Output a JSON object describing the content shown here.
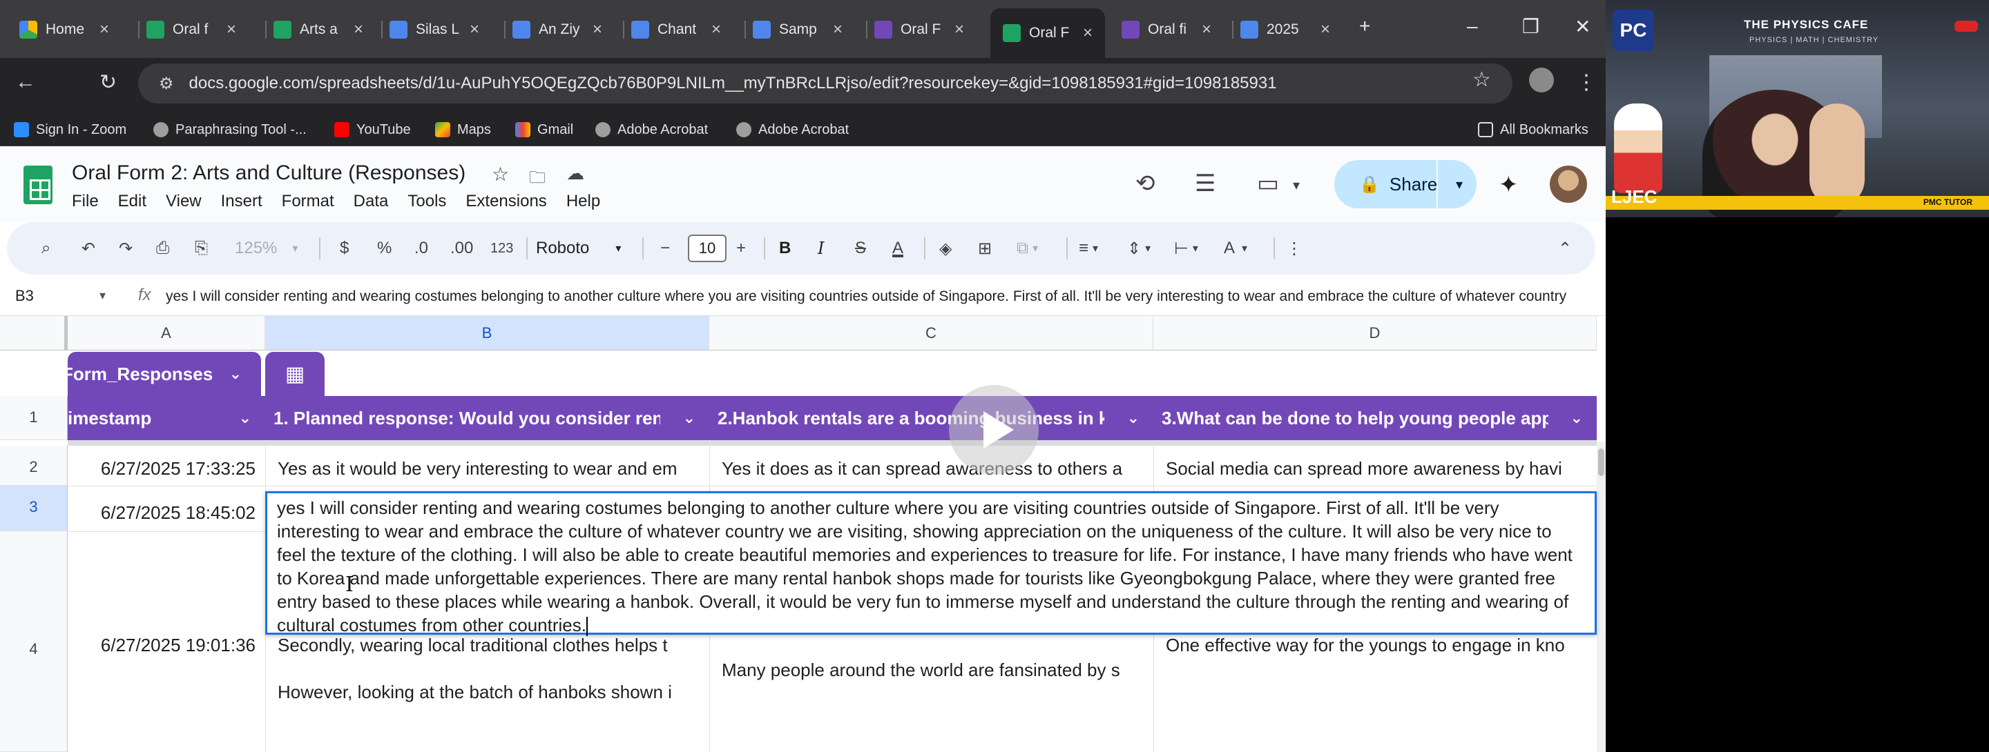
{
  "browser": {
    "tabs": [
      {
        "title": "Home",
        "icon": "drive-icon",
        "active": false
      },
      {
        "title": "Oral f",
        "icon": "sheets-icon",
        "active": false
      },
      {
        "title": "Arts a",
        "icon": "sheets-icon",
        "active": false
      },
      {
        "title": "Silas L",
        "icon": "docs-icon",
        "active": false
      },
      {
        "title": "An Ziy",
        "icon": "docs-icon",
        "active": false
      },
      {
        "title": "Chant",
        "icon": "docs-icon",
        "active": false
      },
      {
        "title": "Samp",
        "icon": "docs-icon",
        "active": false
      },
      {
        "title": "Oral F",
        "icon": "forms-icon",
        "active": false
      },
      {
        "title": "Oral F",
        "icon": "sheets-icon",
        "active": true
      },
      {
        "title": "Oral fi",
        "icon": "forms-icon",
        "active": false
      },
      {
        "title": "2025",
        "icon": "docs-icon",
        "active": false
      }
    ],
    "url": "docs.google.com/spreadsheets/d/1u-AuPuhY5OQEgZQcb76B0P9LNILm__myTnBRcLLRjso/edit?resourcekey=&gid=1098185931#gid=1098185931",
    "bookmarks": [
      {
        "label": "Sign In - Zoom",
        "icon": "zoom-icon"
      },
      {
        "label": "Paraphrasing Tool -...",
        "icon": "paraphrase-icon"
      },
      {
        "label": "YouTube",
        "icon": "youtube-icon"
      },
      {
        "label": "Maps",
        "icon": "maps-icon"
      },
      {
        "label": "Gmail",
        "icon": "gmail-icon"
      },
      {
        "label": "Adobe Acrobat",
        "icon": "acrobat-icon"
      },
      {
        "label": "Adobe Acrobat",
        "icon": "acrobat-icon"
      }
    ],
    "all_bookmarks": "All Bookmarks"
  },
  "app": {
    "title": "Oral Form 2: Arts and Culture (Responses)",
    "menu": [
      "File",
      "Edit",
      "View",
      "Insert",
      "Format",
      "Data",
      "Tools",
      "Extensions",
      "Help"
    ],
    "share_label": "Share"
  },
  "toolbar": {
    "zoom": "125%",
    "currency": "$",
    "percent": "%",
    "decrease_decimal": ".0",
    "increase_decimal": ".00",
    "number_format": "123",
    "font": "Roboto",
    "font_size": "10",
    "bold": "B",
    "italic": "I",
    "strike": "S",
    "text_color": "A",
    "text_style": "A"
  },
  "formula_bar": {
    "cell_ref": "B3",
    "fx": "fx",
    "content": "yes I will consider renting and wearing costumes belonging to another culture where you are visiting countries outside of Singapore. First of all. It'll be very interesting to wear and embrace the culture of whatever country"
  },
  "grid": {
    "columns": [
      "A",
      "B",
      "C",
      "D"
    ],
    "rows": [
      "1",
      "2",
      "3",
      "4"
    ],
    "table_name": "Form_Responses",
    "headers": [
      "imestamp",
      "1. Planned response: Would you consider ren",
      "2.Hanbok rentals are a booming business in k",
      "3.What can be done to help young people app"
    ],
    "data": [
      {
        "a": "6/27/2025 17:33:25",
        "b": "Yes as it would be very interesting to wear and em",
        "c": "Yes it does as it can spread awareness to others a",
        "d": "Social media can spread more awareness by havi"
      },
      {
        "a": "6/27/2025 18:45:02",
        "b": "yes I will consider renting and wearing costumes belonging to another culture where you are visiting countries outside of Singapore. First of all. It'll be very interesting to wear and embrace the culture of whatever country we are visiting, showing appreciation on the uniqueness of the culture. It will also be very nice to feel the texture of the clothing. I will also be able to create beautiful memories and experiences to treasure for life. For instance, I have many friends who have went to Korea and made unforgettable experiences. There are many rental hanbok shops made for tourists like Gyeongbokgung Palace, where they were granted free entry based to these places while wearing a hanbok. Overall, it would be very fun to immerse myself and understand the culture through the renting and wearing of cultural costumes from other countries."
      },
      {
        "a": "6/27/2025 19:01:36",
        "b1": "Secondly, wearing local traditional clothes helps t",
        "b2": "However, looking at the batch of hanboks shown i",
        "c": "Many people around the world are fansinated by s",
        "d": "One effective way for the youngs to engage in kno"
      }
    ]
  },
  "webcam": {
    "logo": "PC",
    "brand": "THE PHYSICS CAFE",
    "sub": "PHYSICS | MATH | CHEMISTRY",
    "name": "LJEC",
    "tutor": "PMC TUTOR"
  },
  "colors": {
    "accent": "#7248b9",
    "sheets_green": "#1ea362",
    "selection_blue": "#1a73e8",
    "share_bg": "#c2e7ff"
  }
}
